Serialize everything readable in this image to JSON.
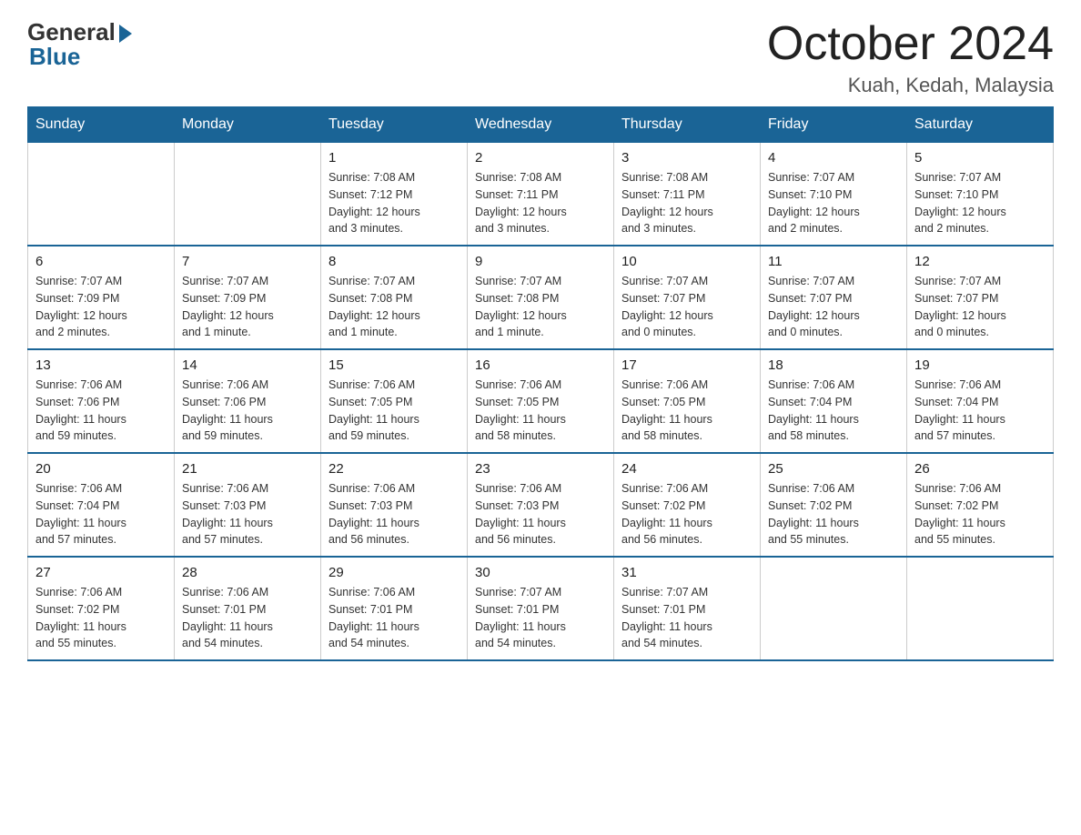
{
  "logo": {
    "general": "General",
    "blue": "Blue"
  },
  "title": "October 2024",
  "subtitle": "Kuah, Kedah, Malaysia",
  "days_of_week": [
    "Sunday",
    "Monday",
    "Tuesday",
    "Wednesday",
    "Thursday",
    "Friday",
    "Saturday"
  ],
  "weeks": [
    [
      {
        "day": "",
        "info": ""
      },
      {
        "day": "",
        "info": ""
      },
      {
        "day": "1",
        "info": "Sunrise: 7:08 AM\nSunset: 7:12 PM\nDaylight: 12 hours\nand 3 minutes."
      },
      {
        "day": "2",
        "info": "Sunrise: 7:08 AM\nSunset: 7:11 PM\nDaylight: 12 hours\nand 3 minutes."
      },
      {
        "day": "3",
        "info": "Sunrise: 7:08 AM\nSunset: 7:11 PM\nDaylight: 12 hours\nand 3 minutes."
      },
      {
        "day": "4",
        "info": "Sunrise: 7:07 AM\nSunset: 7:10 PM\nDaylight: 12 hours\nand 2 minutes."
      },
      {
        "day": "5",
        "info": "Sunrise: 7:07 AM\nSunset: 7:10 PM\nDaylight: 12 hours\nand 2 minutes."
      }
    ],
    [
      {
        "day": "6",
        "info": "Sunrise: 7:07 AM\nSunset: 7:09 PM\nDaylight: 12 hours\nand 2 minutes."
      },
      {
        "day": "7",
        "info": "Sunrise: 7:07 AM\nSunset: 7:09 PM\nDaylight: 12 hours\nand 1 minute."
      },
      {
        "day": "8",
        "info": "Sunrise: 7:07 AM\nSunset: 7:08 PM\nDaylight: 12 hours\nand 1 minute."
      },
      {
        "day": "9",
        "info": "Sunrise: 7:07 AM\nSunset: 7:08 PM\nDaylight: 12 hours\nand 1 minute."
      },
      {
        "day": "10",
        "info": "Sunrise: 7:07 AM\nSunset: 7:07 PM\nDaylight: 12 hours\nand 0 minutes."
      },
      {
        "day": "11",
        "info": "Sunrise: 7:07 AM\nSunset: 7:07 PM\nDaylight: 12 hours\nand 0 minutes."
      },
      {
        "day": "12",
        "info": "Sunrise: 7:07 AM\nSunset: 7:07 PM\nDaylight: 12 hours\nand 0 minutes."
      }
    ],
    [
      {
        "day": "13",
        "info": "Sunrise: 7:06 AM\nSunset: 7:06 PM\nDaylight: 11 hours\nand 59 minutes."
      },
      {
        "day": "14",
        "info": "Sunrise: 7:06 AM\nSunset: 7:06 PM\nDaylight: 11 hours\nand 59 minutes."
      },
      {
        "day": "15",
        "info": "Sunrise: 7:06 AM\nSunset: 7:05 PM\nDaylight: 11 hours\nand 59 minutes."
      },
      {
        "day": "16",
        "info": "Sunrise: 7:06 AM\nSunset: 7:05 PM\nDaylight: 11 hours\nand 58 minutes."
      },
      {
        "day": "17",
        "info": "Sunrise: 7:06 AM\nSunset: 7:05 PM\nDaylight: 11 hours\nand 58 minutes."
      },
      {
        "day": "18",
        "info": "Sunrise: 7:06 AM\nSunset: 7:04 PM\nDaylight: 11 hours\nand 58 minutes."
      },
      {
        "day": "19",
        "info": "Sunrise: 7:06 AM\nSunset: 7:04 PM\nDaylight: 11 hours\nand 57 minutes."
      }
    ],
    [
      {
        "day": "20",
        "info": "Sunrise: 7:06 AM\nSunset: 7:04 PM\nDaylight: 11 hours\nand 57 minutes."
      },
      {
        "day": "21",
        "info": "Sunrise: 7:06 AM\nSunset: 7:03 PM\nDaylight: 11 hours\nand 57 minutes."
      },
      {
        "day": "22",
        "info": "Sunrise: 7:06 AM\nSunset: 7:03 PM\nDaylight: 11 hours\nand 56 minutes."
      },
      {
        "day": "23",
        "info": "Sunrise: 7:06 AM\nSunset: 7:03 PM\nDaylight: 11 hours\nand 56 minutes."
      },
      {
        "day": "24",
        "info": "Sunrise: 7:06 AM\nSunset: 7:02 PM\nDaylight: 11 hours\nand 56 minutes."
      },
      {
        "day": "25",
        "info": "Sunrise: 7:06 AM\nSunset: 7:02 PM\nDaylight: 11 hours\nand 55 minutes."
      },
      {
        "day": "26",
        "info": "Sunrise: 7:06 AM\nSunset: 7:02 PM\nDaylight: 11 hours\nand 55 minutes."
      }
    ],
    [
      {
        "day": "27",
        "info": "Sunrise: 7:06 AM\nSunset: 7:02 PM\nDaylight: 11 hours\nand 55 minutes."
      },
      {
        "day": "28",
        "info": "Sunrise: 7:06 AM\nSunset: 7:01 PM\nDaylight: 11 hours\nand 54 minutes."
      },
      {
        "day": "29",
        "info": "Sunrise: 7:06 AM\nSunset: 7:01 PM\nDaylight: 11 hours\nand 54 minutes."
      },
      {
        "day": "30",
        "info": "Sunrise: 7:07 AM\nSunset: 7:01 PM\nDaylight: 11 hours\nand 54 minutes."
      },
      {
        "day": "31",
        "info": "Sunrise: 7:07 AM\nSunset: 7:01 PM\nDaylight: 11 hours\nand 54 minutes."
      },
      {
        "day": "",
        "info": ""
      },
      {
        "day": "",
        "info": ""
      }
    ]
  ]
}
